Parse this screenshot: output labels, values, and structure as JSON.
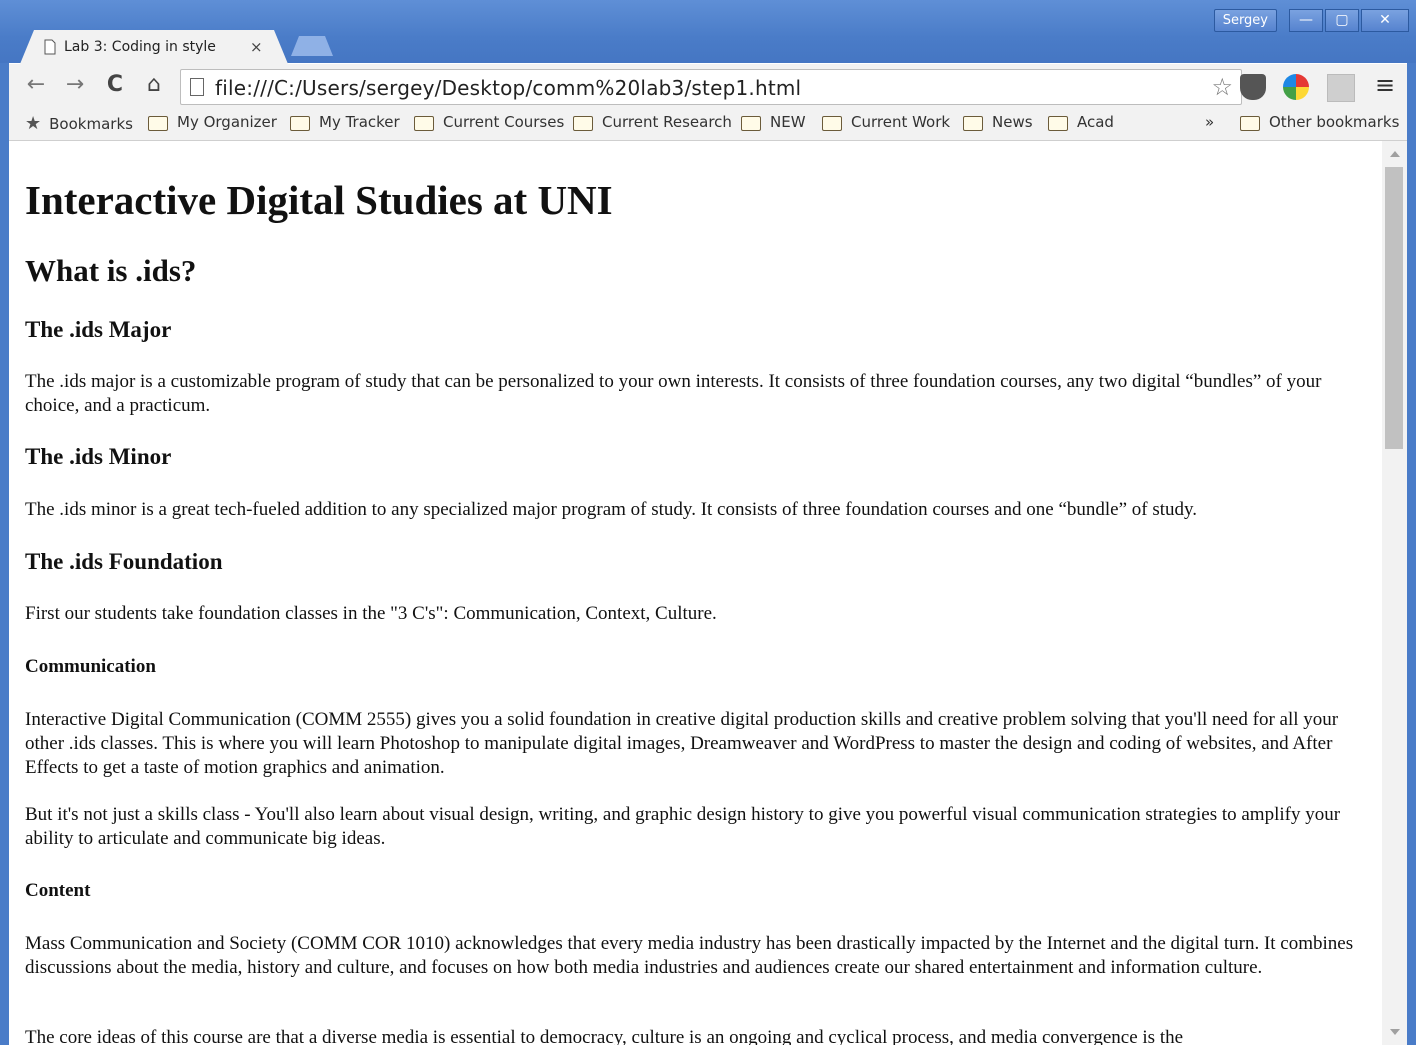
{
  "window": {
    "user_name": "Sergey",
    "minimize_glyph": "—",
    "maximize_glyph": "▢",
    "close_glyph": "✕"
  },
  "tab": {
    "title": "Lab 3: Coding in style",
    "close_glyph": "×"
  },
  "toolbar": {
    "back_glyph": "←",
    "forward_glyph": "→",
    "reload_glyph": "C",
    "home_glyph": "⌂",
    "url": "file:///C:/Users/sergey/Desktop/comm%20lab3/step1.html",
    "star_glyph": "☆",
    "menu_glyph": "≡"
  },
  "bookmarks": {
    "items": [
      {
        "label": "Bookmarks"
      },
      {
        "label": "My Organizer"
      },
      {
        "label": "My Tracker"
      },
      {
        "label": "Current Courses"
      },
      {
        "label": "Current Research"
      },
      {
        "label": "NEW"
      },
      {
        "label": "Current Work"
      },
      {
        "label": "News"
      },
      {
        "label": "Acad"
      }
    ],
    "overflow_glyph": "»",
    "other_label": "Other bookmarks"
  },
  "page": {
    "h1": "Interactive Digital Studies at UNI",
    "h2": "What is .ids?",
    "major_heading": "The .ids Major",
    "major_text": "The .ids major is a customizable program of study that can be personalized to your own interests. It consists of three foundation courses, any two digital “bundles” of your choice, and a practicum.",
    "minor_heading": "The .ids Minor",
    "minor_text": "The .ids minor is a great tech-fueled addition to any specialized major program of study. It consists of three foundation courses and one “bundle” of study.",
    "foundation_heading": "The .ids Foundation",
    "foundation_text": "First our students take foundation classes in the \"3 C's\": Communication, Context, Culture.",
    "communication_heading": "Communication",
    "communication_text_1": "Interactive Digital Communication (COMM 2555) gives you a solid foundation in creative digital production skills and creative problem solving that you'll need for all your other .ids classes. This is where you will learn Photoshop to manipulate digital images, Dreamweaver and WordPress to master the design and coding of websites, and After Effects to get a taste of motion graphics and animation.",
    "communication_text_2": "But it's not just a skills class - You'll also learn about visual design, writing, and graphic design history to give you powerful visual communication strategies to amplify your ability to articulate and communicate big ideas.",
    "content_heading": "Content",
    "content_text_1": "Mass Communication and Society (COMM COR 1010) acknowledges that every media industry has been drastically impacted by the Internet and the digital turn. It combines discussions about the media, history and culture, and focuses on how both media industries and audiences create our shared entertainment and information culture.",
    "content_text_2": "The core ideas of this course are that a diverse media is essential to democracy, culture is an ongoing and cyclical process, and media convergence is the"
  }
}
